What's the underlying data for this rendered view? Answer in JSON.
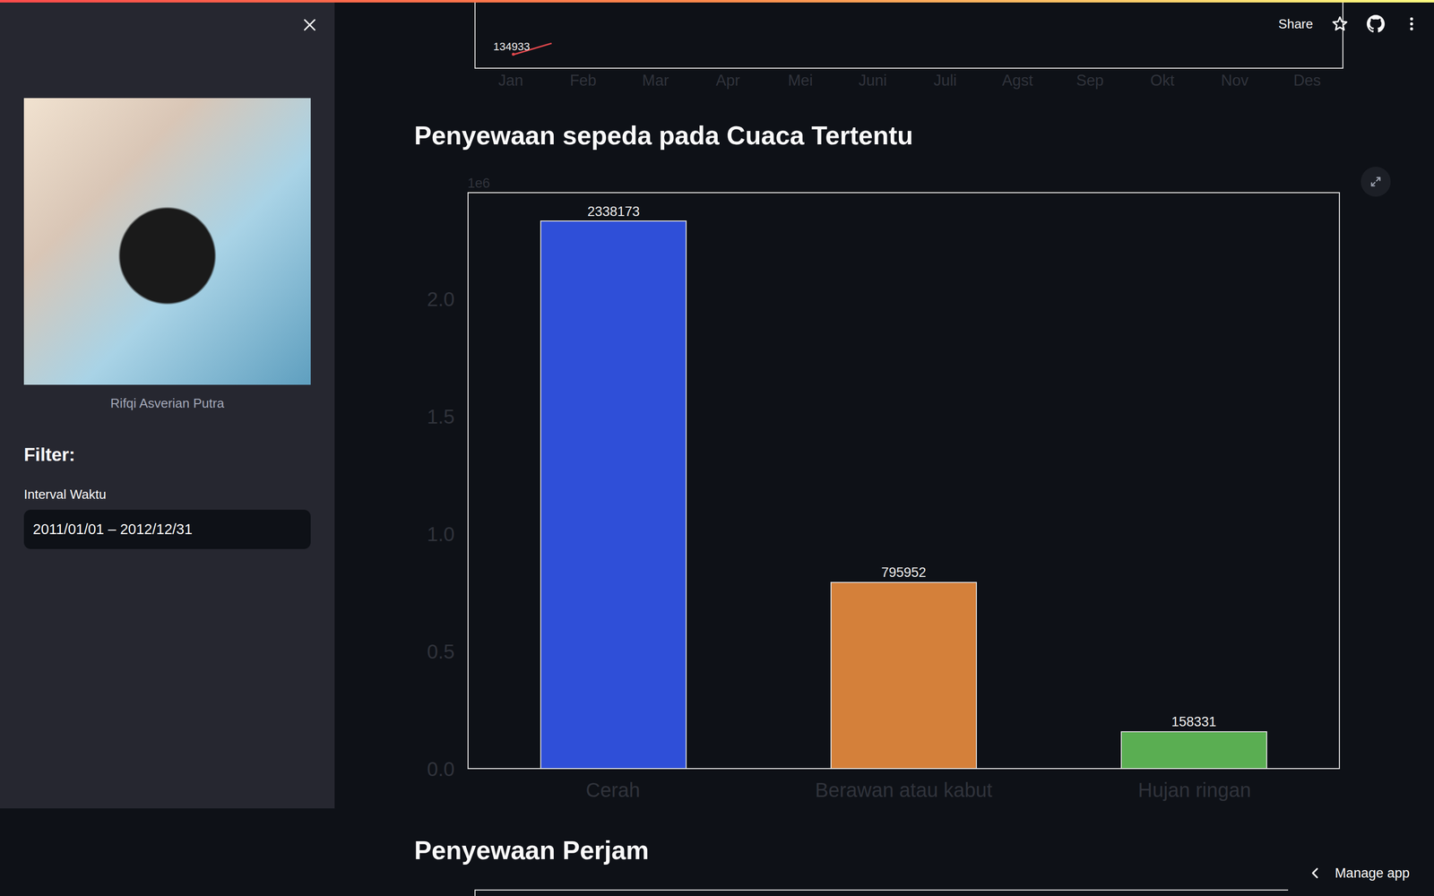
{
  "header": {
    "share": "Share"
  },
  "sidebar": {
    "caption": "Rifqi Asverian Putra",
    "filter_title": "Filter:",
    "date_label": "Interval Waktu",
    "date_value": "2011/01/01 – 2012/12/31"
  },
  "monthly_chart": {
    "months": [
      "Jan",
      "Feb",
      "Mar",
      "Apr",
      "Mei",
      "Juni",
      "Juli",
      "Agst",
      "Sep",
      "Okt",
      "Nov",
      "Des"
    ],
    "series": {
      "color": "#e0474c",
      "values": [
        134933
      ],
      "labels": [
        "134933"
      ]
    }
  },
  "weather_chart": {
    "title": "Penyewaan sepeda pada Cuaca Tertentu",
    "offset_label": "1e6",
    "y_max": 2455082,
    "ticks": [
      {
        "label": "0.0",
        "value": 0
      },
      {
        "label": "0.5",
        "value": 500000
      },
      {
        "label": "1.0",
        "value": 1000000
      },
      {
        "label": "1.5",
        "value": 1500000
      },
      {
        "label": "2.0",
        "value": 2000000
      }
    ],
    "bars": [
      {
        "label": "Cerah",
        "value": 2338173,
        "value_text": "2338173",
        "color": "#2f4fd8"
      },
      {
        "label": "Berawan atau kabut",
        "value": 795952,
        "value_text": "795952",
        "color": "#d4803a"
      },
      {
        "label": "Hujan ringan",
        "value": 158331,
        "value_text": "158331",
        "color": "#5aae52"
      }
    ]
  },
  "hourly_chart": {
    "title": "Penyewaan Perjam"
  },
  "manage_app": {
    "label": "Manage app"
  }
}
